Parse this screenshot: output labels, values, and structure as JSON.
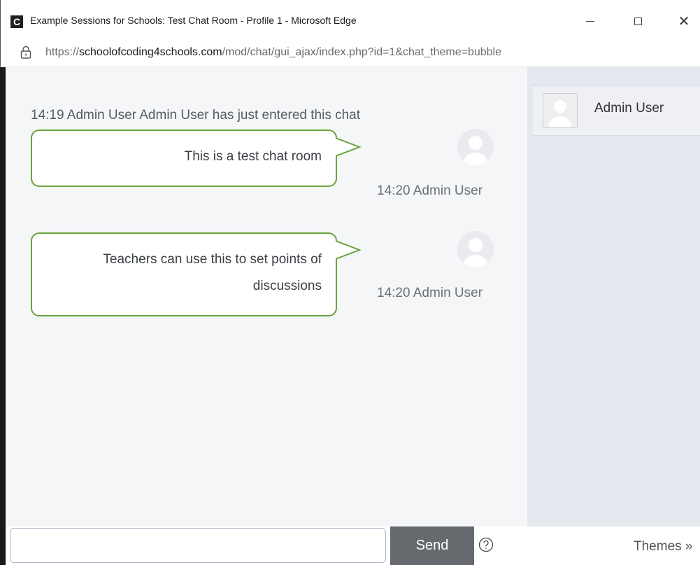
{
  "window": {
    "app_icon": "C",
    "title": "Example Sessions for Schools: Test Chat Room - Profile 1 - Microsoft Edge",
    "close_glyph": "✕"
  },
  "address": {
    "scheme": "https://",
    "host": "schoolofcoding4schools.com",
    "path": "/mod/chat/gui_ajax/index.php?id=1&chat_theme=bubble"
  },
  "chat": {
    "system_message": "14:19 Admin User Admin User has just entered this chat",
    "messages": [
      {
        "text": "This is a test chat room",
        "meta": "14:20 Admin User"
      },
      {
        "text": "Teachers can use this to set points of discussions",
        "meta": "14:20 Admin User"
      }
    ]
  },
  "users": [
    {
      "name": "Admin User"
    }
  ],
  "composer": {
    "input_value": "",
    "send_label": "Send",
    "themes_label": "Themes »"
  },
  "colors": {
    "bubble_border": "#6aa33a",
    "send_button": "#666a6e",
    "chat_background": "#f5f6f8",
    "users_background": "#e5e8ee"
  }
}
